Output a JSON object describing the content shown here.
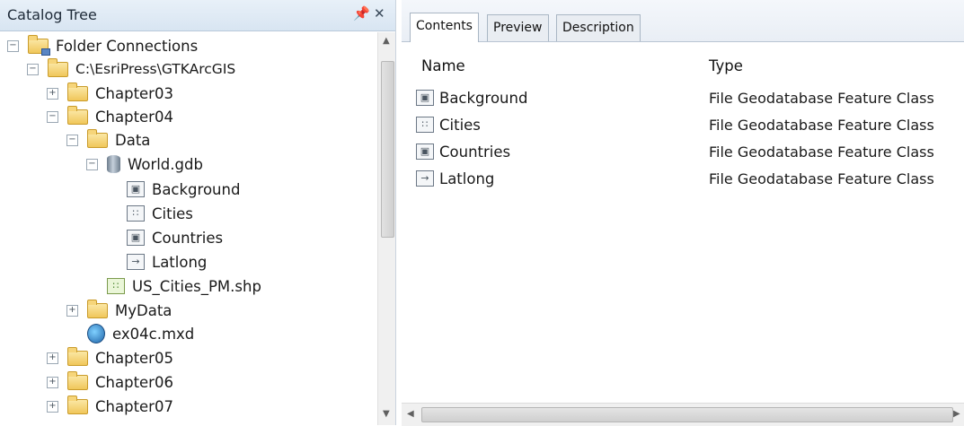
{
  "catalog": {
    "title": "Catalog Tree",
    "pin_icon": "pin-icon",
    "close_icon": "close-icon",
    "tree": {
      "folder_connections": "Folder Connections",
      "root_path": "C:\\EsriPress\\GTKArcGIS",
      "chapter03": "Chapter03",
      "chapter04": "Chapter04",
      "data": "Data",
      "world_gdb": "World.gdb",
      "background": "Background",
      "cities": "Cities",
      "countries": "Countries",
      "latlong": "Latlong",
      "us_cities": "US_Cities_PM.shp",
      "mydata": "MyData",
      "mxd": "ex04c.mxd",
      "chapter05": "Chapter05",
      "chapter06": "Chapter06",
      "chapter07": "Chapter07"
    }
  },
  "contents": {
    "tabs": [
      "Contents",
      "Preview",
      "Description"
    ],
    "columns": {
      "name": "Name",
      "type": "Type"
    },
    "items": [
      {
        "name": "Background",
        "type": "File Geodatabase Feature Class",
        "icon": "polygon-feature-icon"
      },
      {
        "name": "Cities",
        "type": "File Geodatabase Feature Class",
        "icon": "point-feature-icon"
      },
      {
        "name": "Countries",
        "type": "File Geodatabase Feature Class",
        "icon": "polygon-feature-icon"
      },
      {
        "name": "Latlong",
        "type": "File Geodatabase Feature Class",
        "icon": "line-feature-icon"
      }
    ]
  },
  "colors": {
    "title_bar": "#dce8f4",
    "folder": "#f0c75a",
    "accent": "#5a86c4"
  }
}
